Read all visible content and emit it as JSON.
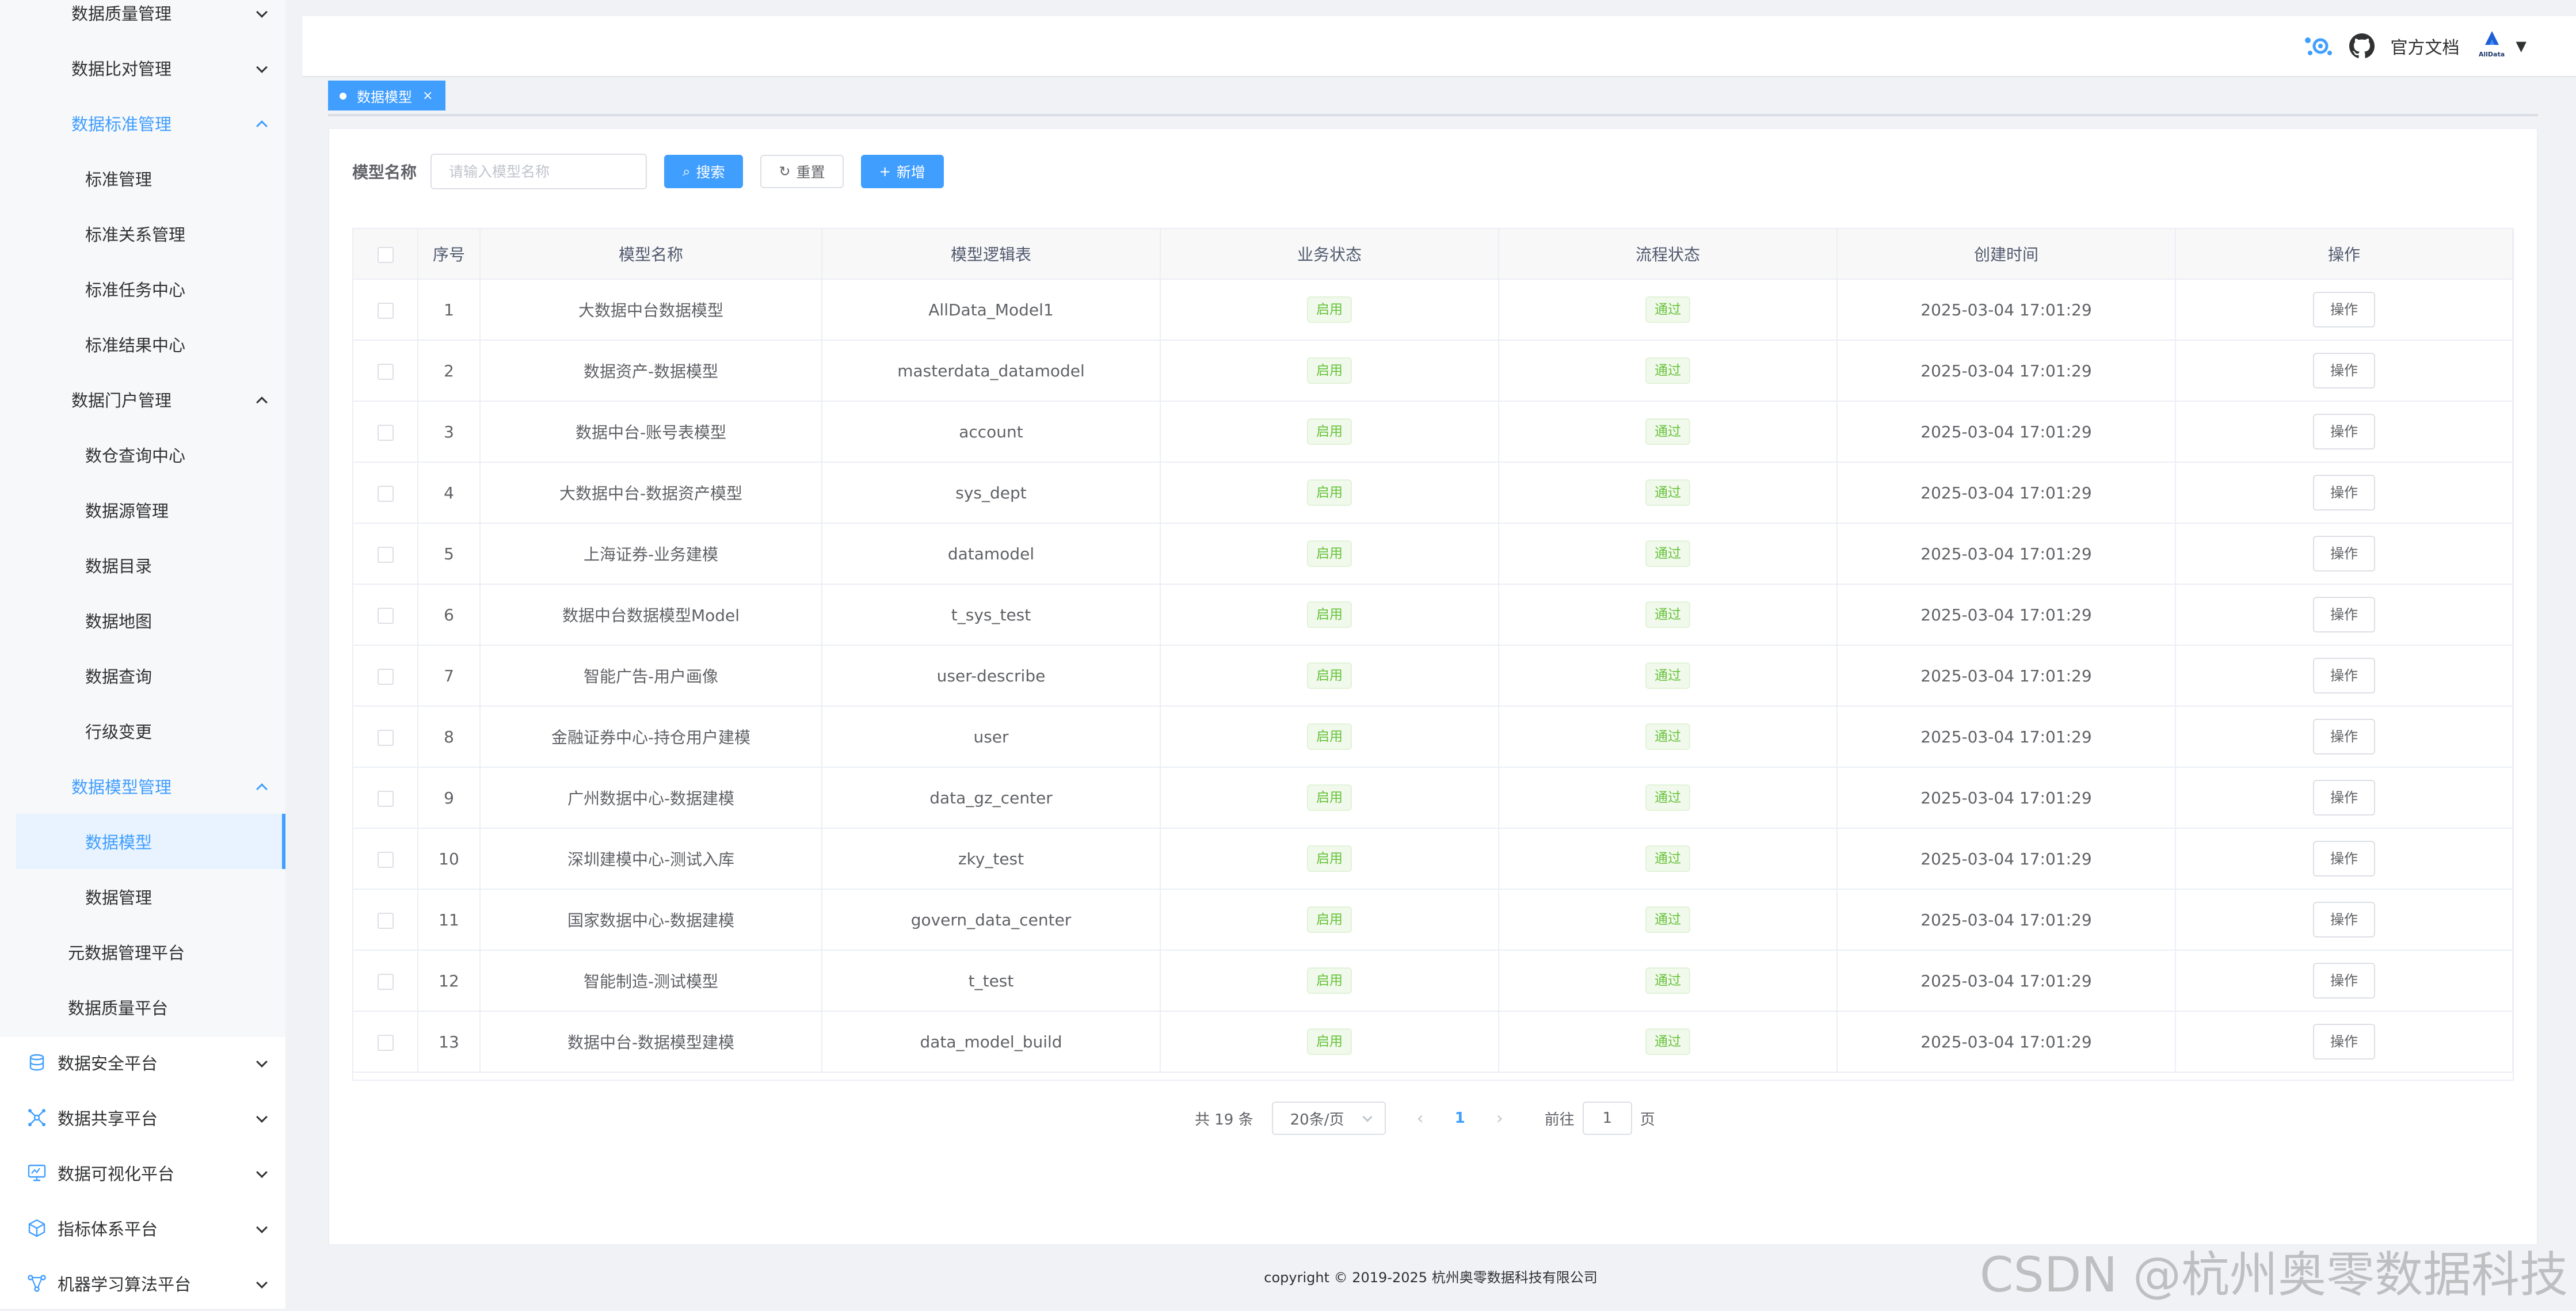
{
  "sidebar": {
    "items": [
      {
        "label": "数据质量管理",
        "state": "collapsed"
      },
      {
        "label": "数据比对管理",
        "state": "collapsed"
      },
      {
        "label": "数据标准管理",
        "state": "expanded-active"
      },
      {
        "label": "标准管理"
      },
      {
        "label": "标准关系管理"
      },
      {
        "label": "标准任务中心"
      },
      {
        "label": "标准结果中心"
      },
      {
        "label": "数据门户管理",
        "state": "expanded"
      },
      {
        "label": "数仓查询中心"
      },
      {
        "label": "数据源管理"
      },
      {
        "label": "数据目录"
      },
      {
        "label": "数据地图"
      },
      {
        "label": "数据查询"
      },
      {
        "label": "行级变更"
      },
      {
        "label": "数据模型管理",
        "state": "expanded-active"
      },
      {
        "label": "数据模型",
        "state": "selected"
      },
      {
        "label": "数据管理"
      },
      {
        "label": "元数据管理平台"
      },
      {
        "label": "数据质量平台"
      },
      {
        "label": "数据安全平台",
        "icon": "database-icon",
        "state": "collapsed"
      },
      {
        "label": "数据共享平台",
        "icon": "network-icon",
        "state": "collapsed"
      },
      {
        "label": "数据可视化平台",
        "icon": "monitor-icon",
        "state": "collapsed"
      },
      {
        "label": "指标体系平台",
        "icon": "cube-icon",
        "state": "collapsed"
      },
      {
        "label": "机器学习算法平台",
        "icon": "flow-icon",
        "state": "collapsed"
      }
    ]
  },
  "header": {
    "docs_label": "官方文档",
    "brand_text": "AllData",
    "icons": [
      "settings-icon",
      "github-icon"
    ]
  },
  "tags": [
    {
      "label": "数据模型",
      "close": "×"
    }
  ],
  "search": {
    "label": "模型名称",
    "placeholder": "请输入模型名称",
    "value": "",
    "search_label": "搜索",
    "reset_label": "重置",
    "add_label": "新增"
  },
  "table": {
    "columns": [
      "序号",
      "模型名称",
      "模型逻辑表",
      "业务状态",
      "流程状态",
      "创建时间",
      "操作"
    ],
    "rows": [
      {
        "no": "1",
        "name": "大数据中台数据模型",
        "table": "AllData_Model1",
        "biz": "启用",
        "flow": "通过",
        "time": "2025-03-04 17:01:29",
        "op": "操作"
      },
      {
        "no": "2",
        "name": "数据资产-数据模型",
        "table": "masterdata_datamodel",
        "biz": "启用",
        "flow": "通过",
        "time": "2025-03-04 17:01:29",
        "op": "操作"
      },
      {
        "no": "3",
        "name": "数据中台-账号表模型",
        "table": "account",
        "biz": "启用",
        "flow": "通过",
        "time": "2025-03-04 17:01:29",
        "op": "操作"
      },
      {
        "no": "4",
        "name": "大数据中台-数据资产模型",
        "table": "sys_dept",
        "biz": "启用",
        "flow": "通过",
        "time": "2025-03-04 17:01:29",
        "op": "操作"
      },
      {
        "no": "5",
        "name": "上海证券-业务建模",
        "table": "datamodel",
        "biz": "启用",
        "flow": "通过",
        "time": "2025-03-04 17:01:29",
        "op": "操作"
      },
      {
        "no": "6",
        "name": "数据中台数据模型Model",
        "table": "t_sys_test",
        "biz": "启用",
        "flow": "通过",
        "time": "2025-03-04 17:01:29",
        "op": "操作"
      },
      {
        "no": "7",
        "name": "智能广告-用户画像",
        "table": "user-describe",
        "biz": "启用",
        "flow": "通过",
        "time": "2025-03-04 17:01:29",
        "op": "操作"
      },
      {
        "no": "8",
        "name": "金融证券中心-持仓用户建模",
        "table": "user",
        "biz": "启用",
        "flow": "通过",
        "time": "2025-03-04 17:01:29",
        "op": "操作"
      },
      {
        "no": "9",
        "name": "广州数据中心-数据建模",
        "table": "data_gz_center",
        "biz": "启用",
        "flow": "通过",
        "time": "2025-03-04 17:01:29",
        "op": "操作"
      },
      {
        "no": "10",
        "name": "深圳建模中心-测试入库",
        "table": "zky_test",
        "biz": "启用",
        "flow": "通过",
        "time": "2025-03-04 17:01:29",
        "op": "操作"
      },
      {
        "no": "11",
        "name": "国家数据中心-数据建模",
        "table": "govern_data_center",
        "biz": "启用",
        "flow": "通过",
        "time": "2025-03-04 17:01:29",
        "op": "操作"
      },
      {
        "no": "12",
        "name": "智能制造-测试模型",
        "table": "t_test",
        "biz": "启用",
        "flow": "通过",
        "time": "2025-03-04 17:01:29",
        "op": "操作"
      },
      {
        "no": "13",
        "name": "数据中台-数据模型建模",
        "table": "data_model_build",
        "biz": "启用",
        "flow": "通过",
        "time": "2025-03-04 17:01:29",
        "op": "操作"
      }
    ]
  },
  "pagination": {
    "total_label": "共 19 条",
    "page_size": "20条/页",
    "prev": "‹",
    "current_page": "1",
    "next": "›",
    "goto_label": "前往",
    "goto_value": "1",
    "page_unit": "页"
  },
  "footer": {
    "copyright": "copyright © 2019-2025 杭州奥零数据科技有限公司"
  },
  "watermark": "CSDN @杭州奥零数据科技",
  "colors": {
    "accent": "#409eff",
    "success": "#67c23a",
    "success_bg": "#f0f9eb",
    "page_bg": "#f0f2f5"
  }
}
